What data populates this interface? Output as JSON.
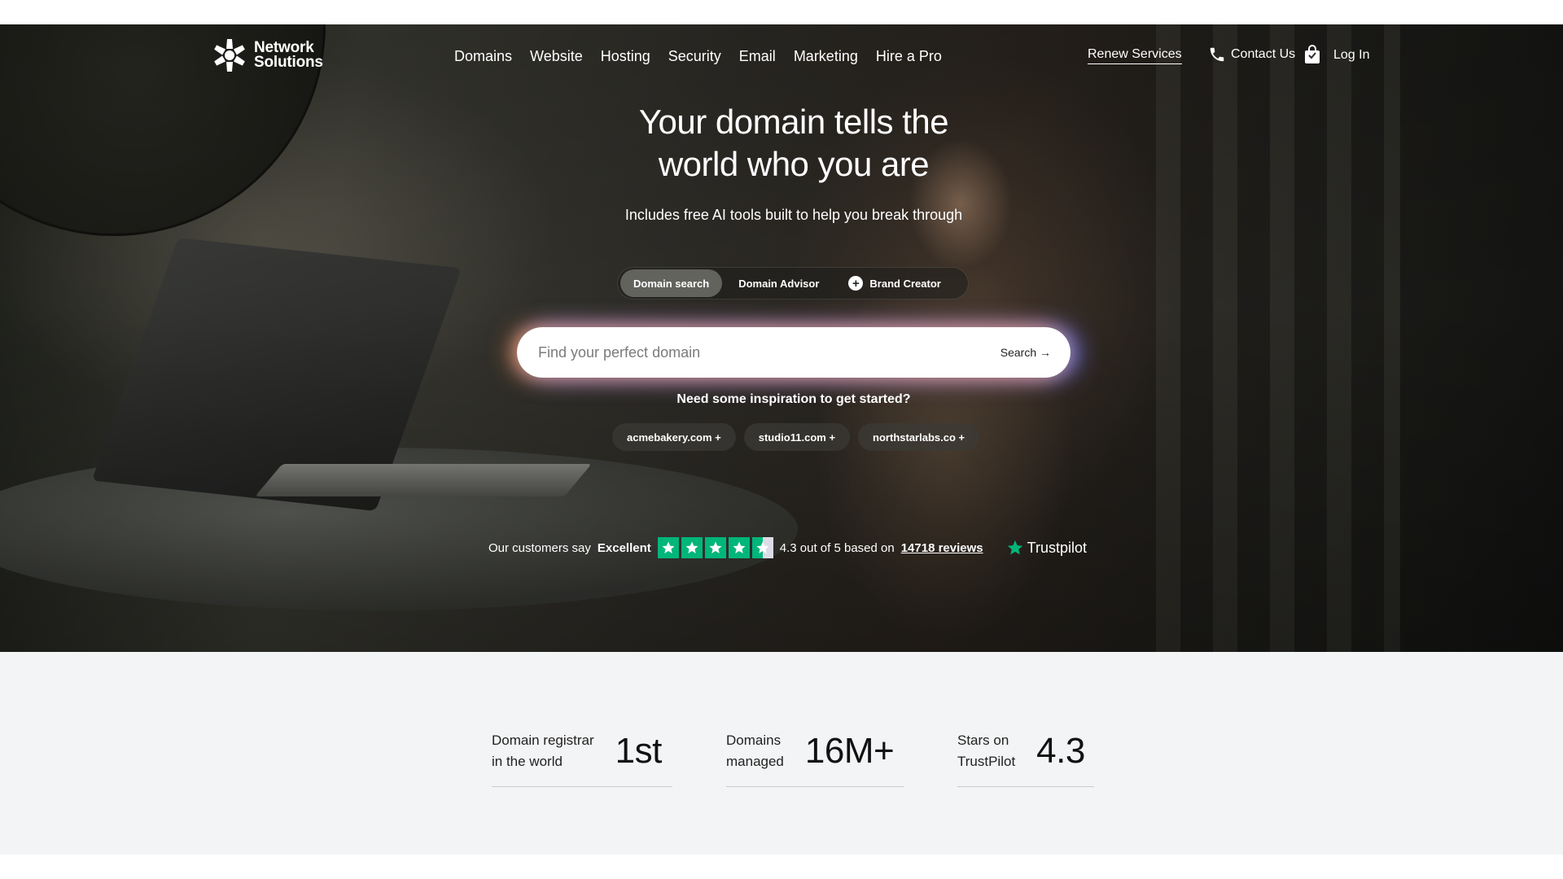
{
  "brand": {
    "line1": "Network",
    "line2": "Solutions",
    "logo_icon": "flower-logo-icon"
  },
  "nav": {
    "links": [
      "Domains",
      "Website",
      "Hosting",
      "Security",
      "Email",
      "Marketing",
      "Hire a Pro"
    ],
    "renew_label": "Renew Services",
    "contact_label": "Contact Us",
    "contact_icon": "phone-icon",
    "cart_icon": "shopping-bag-icon",
    "login_label": "Log In"
  },
  "hero": {
    "headline_line1": "Your domain tells the",
    "headline_line2": "world who you are",
    "subhead": "Includes free AI tools built to help you break through",
    "tabs": [
      "Domain search",
      "Domain Advisor",
      "Brand Creator"
    ],
    "active_tab": "Domain search",
    "search": {
      "placeholder": "Find your perfect domain",
      "value": "",
      "button_label": "Search →"
    },
    "inspiration_text": "Need some inspiration to get started?",
    "suggestions": [
      "acmebakery.com +",
      "studio11.com +",
      "northstarlabs.co +"
    ]
  },
  "trustpilot": {
    "prefix": "Our customers say",
    "rating_word": "Excellent",
    "stars_value": 4.3,
    "stars_max": 5,
    "summary": "4.3 out of 5 based on",
    "reviews_link": "14718 reviews",
    "brand": "Trustpilot",
    "accent_color": "#00b67a"
  },
  "stats": [
    {
      "label_line1": "Domain registrar",
      "label_line2": "in the world",
      "value": "1st"
    },
    {
      "label_line1": "Domains",
      "label_line2": "managed",
      "value": "16M+"
    },
    {
      "label_line1": "Stars on",
      "label_line2": "TrustPilot",
      "value": "4.3"
    }
  ]
}
